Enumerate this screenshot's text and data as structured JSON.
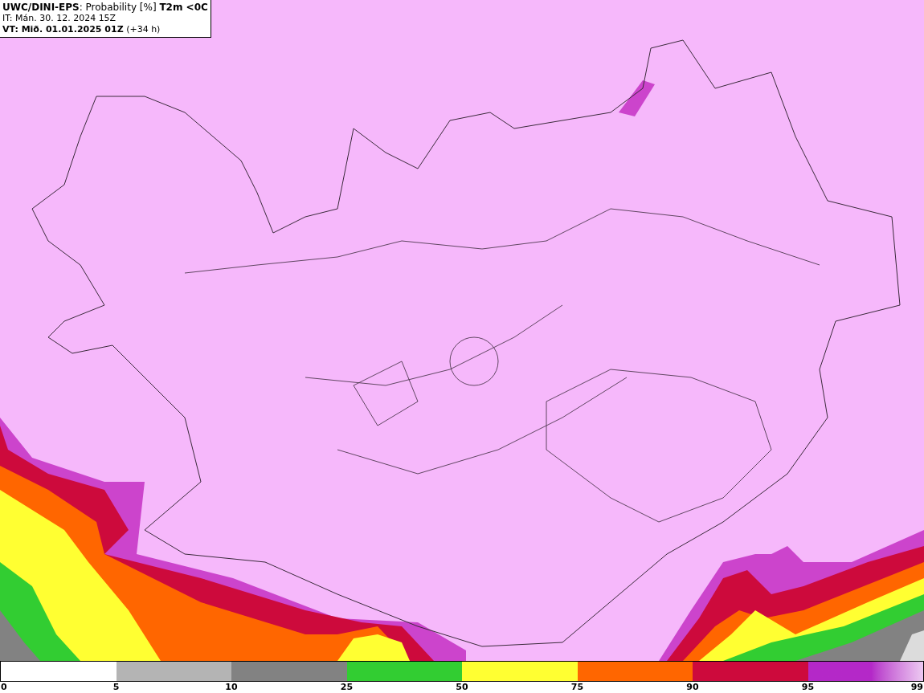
{
  "header": {
    "title": "**UWC/DINI-EPS**: Probability [%] **T2m <0C**",
    "initial_time": "IT: Mán. 30. 12. 2024 15Z",
    "valid_time": "**VT: Mið. 01.01.2025 01Z** (+34 h)"
  },
  "colorbar": {
    "segments": [
      {
        "kind": "solid",
        "color": "#b4b4b4"
      },
      {
        "kind": "solid",
        "color": "#828282"
      },
      {
        "kind": "solid",
        "color": "#32cd32"
      },
      {
        "kind": "solid",
        "color": "#ffff32"
      },
      {
        "kind": "solid",
        "color": "#ff6600"
      },
      {
        "kind": "solid",
        "color": "#cd0a3c"
      },
      {
        "kind": "gradient",
        "color": "#b428c8"
      }
    ],
    "ticks": [
      "0",
      "5",
      "10",
      "25",
      "50",
      "75",
      "90",
      "95",
      "99"
    ]
  }
}
